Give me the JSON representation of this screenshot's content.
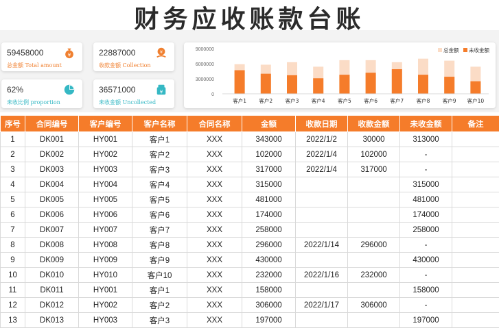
{
  "title": "财务应收账款台账",
  "cards": [
    {
      "value": "59458000",
      "label": "总金额 Total amount",
      "icon": "money-bag-icon"
    },
    {
      "value": "22887000",
      "label": "收款金额 Collection",
      "icon": "coin-hand-icon"
    },
    {
      "value": "62%",
      "label": "未收比例 proportion",
      "icon": "pie-chart-icon"
    },
    {
      "value": "36571000",
      "label": "未收金额 Uncollected",
      "icon": "yen-box-icon"
    }
  ],
  "colors": {
    "accent": "#f57c2a",
    "light": "#fbdcc6",
    "teal": "#35b8c4"
  },
  "chart_data": {
    "type": "bar",
    "categories": [
      "客户1",
      "客户2",
      "客户3",
      "客户4",
      "客户5",
      "客户6",
      "客户7",
      "客户8",
      "客户9",
      "客户10"
    ],
    "series": [
      {
        "name": "总金额",
        "values": [
          5900000,
          5800000,
          6300000,
          5400000,
          6700000,
          6700000,
          6300000,
          7000000,
          6600000,
          5400000
        ]
      },
      {
        "name": "未收金额",
        "values": [
          4700000,
          4000000,
          3700000,
          3100000,
          3800000,
          4200000,
          4900000,
          3800000,
          3400000,
          2500000
        ]
      }
    ],
    "yticks": [
      "9000000",
      "6000000",
      "3000000",
      "0"
    ],
    "ylim": [
      0,
      9000000
    ],
    "legend": "top-right"
  },
  "table": {
    "headers": [
      "序号",
      "合同编号",
      "客户编号",
      "客户名称",
      "合同名称",
      "金额",
      "收款日期",
      "收款金额",
      "未收金额",
      "备注"
    ],
    "rows": [
      [
        "1",
        "DK001",
        "HY001",
        "客户1",
        "XXX",
        "343000",
        "2022/1/2",
        "30000",
        "313000",
        ""
      ],
      [
        "2",
        "DK002",
        "HY002",
        "客户2",
        "XXX",
        "102000",
        "2022/1/4",
        "102000",
        "-",
        ""
      ],
      [
        "3",
        "DK003",
        "HY003",
        "客户3",
        "XXX",
        "317000",
        "2022/1/4",
        "317000",
        "-",
        ""
      ],
      [
        "4",
        "DK004",
        "HY004",
        "客户4",
        "XXX",
        "315000",
        "",
        "",
        "315000",
        ""
      ],
      [
        "5",
        "DK005",
        "HY005",
        "客户5",
        "XXX",
        "481000",
        "",
        "",
        "481000",
        ""
      ],
      [
        "6",
        "DK006",
        "HY006",
        "客户6",
        "XXX",
        "174000",
        "",
        "",
        "174000",
        ""
      ],
      [
        "7",
        "DK007",
        "HY007",
        "客户7",
        "XXX",
        "258000",
        "",
        "",
        "258000",
        ""
      ],
      [
        "8",
        "DK008",
        "HY008",
        "客户8",
        "XXX",
        "296000",
        "2022/1/14",
        "296000",
        "-",
        ""
      ],
      [
        "9",
        "DK009",
        "HY009",
        "客户9",
        "XXX",
        "430000",
        "",
        "",
        "430000",
        ""
      ],
      [
        "10",
        "DK010",
        "HY010",
        "客户10",
        "XXX",
        "232000",
        "2022/1/16",
        "232000",
        "-",
        ""
      ],
      [
        "11",
        "DK011",
        "HY001",
        "客户1",
        "XXX",
        "158000",
        "",
        "",
        "158000",
        ""
      ],
      [
        "12",
        "DK012",
        "HY002",
        "客户2",
        "XXX",
        "306000",
        "2022/1/17",
        "306000",
        "-",
        ""
      ],
      [
        "13",
        "DK013",
        "HY003",
        "客户3",
        "XXX",
        "197000",
        "",
        "",
        "197000",
        ""
      ]
    ]
  }
}
